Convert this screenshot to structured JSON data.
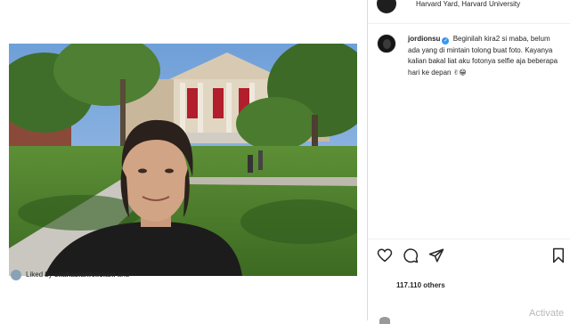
{
  "post": {
    "location": "Harvard Yard, Harvard University",
    "caption": {
      "username": "jordionsu",
      "text": "Beginilah kira2 si maba, belum ada yang di mintain tolong buat foto. Kayanya kalian bakal liat aku fotonya selfie aja beberapa hari ke depan ✌😁",
      "verified_glyph": "✓"
    },
    "likes": {
      "prefix": "Liked by",
      "liker": "silahasianfeliciani",
      "and": "and",
      "others": "117.110 others"
    },
    "icons": [
      "heart-icon",
      "comment-icon",
      "share-icon",
      "bookmark-icon"
    ]
  },
  "overlay": {
    "watermark": "Activate"
  },
  "colors": {
    "verified": "#3897f0",
    "text": "#262626",
    "divider": "#dbdbdb",
    "banner_red": "#b21e2b"
  }
}
